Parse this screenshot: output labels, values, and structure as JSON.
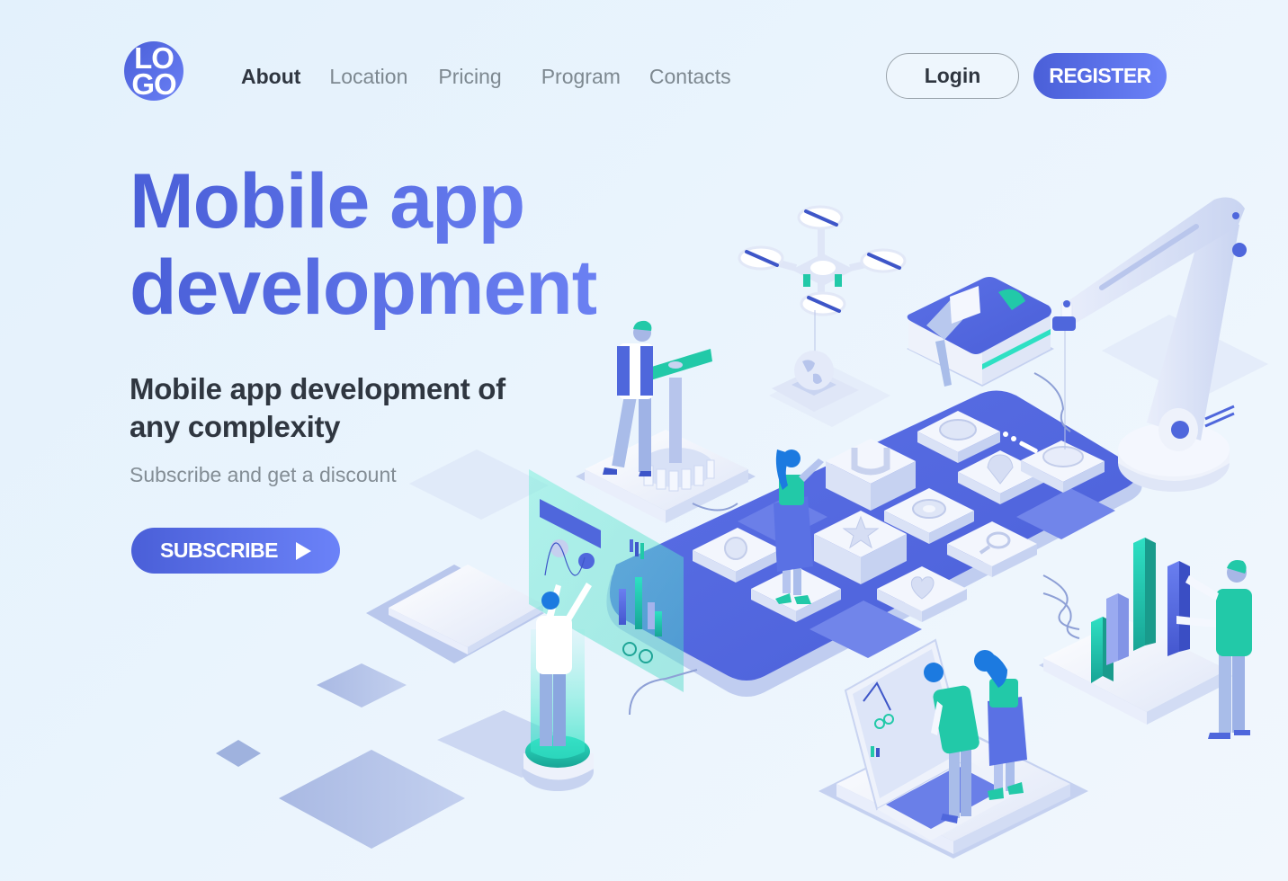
{
  "logo": {
    "line1": "LO",
    "line2": "GO"
  },
  "nav": {
    "items": [
      {
        "label": "About",
        "active": true
      },
      {
        "label": "Location",
        "active": false
      },
      {
        "label": "Pricing",
        "active": false
      },
      {
        "label": "Program",
        "active": false
      },
      {
        "label": "Contacts",
        "active": false
      }
    ]
  },
  "auth": {
    "login_label": "Login",
    "register_label": "REGISTER"
  },
  "hero": {
    "title_line1": "Mobile app",
    "title_line2": "development",
    "subtitle": "Mobile app development of any complexity",
    "caption": "Subscribe and get a discount",
    "cta_label": "SUBSCRIBE",
    "cta_icon": "play-icon"
  },
  "illustration": {
    "description": "Isometric mobile app development scene",
    "icons": [
      "drone-icon",
      "globe-icon",
      "gear-icon",
      "star-icon",
      "heart-icon",
      "search-icon",
      "location-pin-icon",
      "coin-icon",
      "bar-chart-icon",
      "robot-arm-icon",
      "laptop-icon"
    ]
  },
  "colors": {
    "brand": "#5369e2",
    "brand_light": "#6b82f8",
    "accent_teal": "#22c9b0",
    "text_dark": "#2f3640",
    "text_muted": "#7d8890",
    "background": "#e6f2fc"
  }
}
